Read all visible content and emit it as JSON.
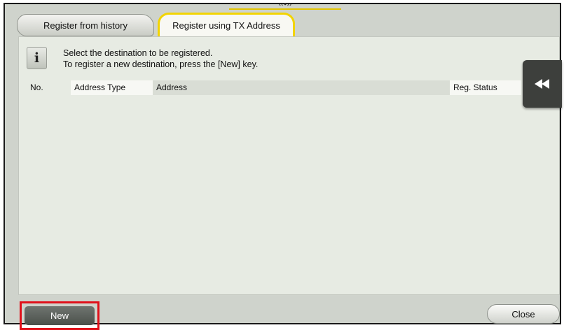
{
  "tabs": [
    {
      "label": "Register from history"
    },
    {
      "label": "Register using TX Address"
    }
  ],
  "message": {
    "line1": "Select the destination to be registered.",
    "line2": "To register a new destination, press the [New] key."
  },
  "table": {
    "columns": [
      "No.",
      "Address Type",
      "Address",
      "Reg. Status"
    ],
    "rows": []
  },
  "buttons": {
    "new_label": "New",
    "close_label": "Close"
  },
  "icons": {
    "info": "info-icon",
    "rewind": "double-left-arrow-icon",
    "handle": "drag-handle-icon"
  },
  "colors": {
    "active_tab_border": "#f2d400",
    "highlight_border": "#e0101a"
  }
}
